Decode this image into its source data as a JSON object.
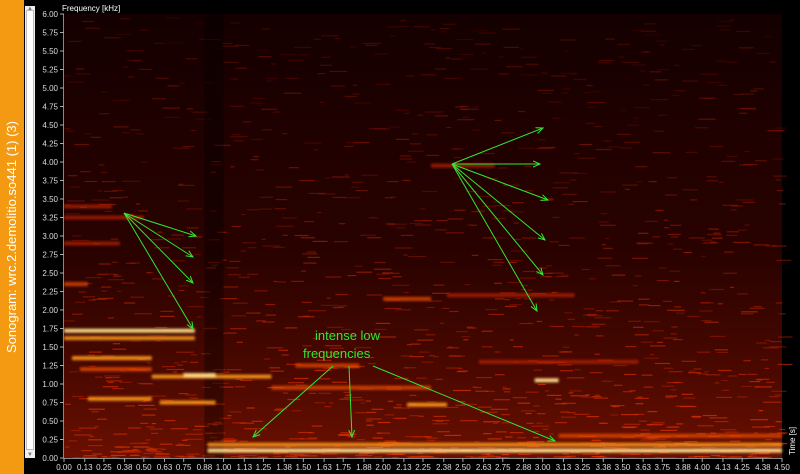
{
  "sidebar": {
    "title": "Sonogram: wrc.2.demolitio.so441 (1) (3)"
  },
  "chart_data": {
    "type": "heatmap",
    "title": "",
    "ylabel": "Frequency [kHz]",
    "xlabel": "Time [s]",
    "xlim": [
      0,
      4.5
    ],
    "ylim": [
      0,
      6
    ],
    "x_ticks": [
      "0.00",
      "0.13",
      "0.25",
      "0.38",
      "0.50",
      "0.63",
      "0.75",
      "0.88",
      "1.00",
      "1.13",
      "1.25",
      "1.38",
      "1.50",
      "1.63",
      "1.75",
      "1.88",
      "2.00",
      "2.13",
      "2.25",
      "2.38",
      "2.50",
      "2.63",
      "2.75",
      "2.88",
      "3.00",
      "3.13",
      "3.25",
      "3.38",
      "3.50",
      "3.63",
      "3.75",
      "3.88",
      "4.00",
      "4.13",
      "4.25",
      "4.38",
      "4.50"
    ],
    "y_ticks": [
      "0.00",
      "0.25",
      "0.50",
      "0.75",
      "1.00",
      "1.25",
      "1.50",
      "1.75",
      "2.00",
      "2.25",
      "2.50",
      "2.75",
      "3.00",
      "3.25",
      "3.50",
      "3.75",
      "4.00",
      "4.25",
      "4.50",
      "4.75",
      "5.00",
      "5.25",
      "5.50",
      "5.75",
      "6.00"
    ],
    "annotations": [
      {
        "text": "intense low frequencies",
        "lines": [
          "intense low",
          "frequencies"
        ]
      }
    ],
    "bright_bands": [
      {
        "t0": 0.0,
        "t1": 0.82,
        "f": 1.72,
        "i": 1.0
      },
      {
        "t0": 0.0,
        "t1": 0.82,
        "f": 1.62,
        "i": 0.8
      },
      {
        "t0": 0.05,
        "t1": 0.55,
        "f": 1.35,
        "i": 0.9
      },
      {
        "t0": 0.1,
        "t1": 0.55,
        "f": 1.2,
        "i": 0.7
      },
      {
        "t0": 0.55,
        "t1": 1.3,
        "f": 1.1,
        "i": 0.85
      },
      {
        "t0": 0.75,
        "t1": 0.95,
        "f": 1.12,
        "i": 1.0
      },
      {
        "t0": 0.15,
        "t1": 0.55,
        "f": 0.8,
        "i": 0.9
      },
      {
        "t0": 0.6,
        "t1": 0.95,
        "f": 0.75,
        "i": 0.85
      },
      {
        "t0": 1.3,
        "t1": 2.3,
        "f": 0.95,
        "i": 0.6
      },
      {
        "t0": 1.45,
        "t1": 1.85,
        "f": 1.25,
        "i": 0.6
      },
      {
        "t0": 2.15,
        "t1": 2.4,
        "f": 0.72,
        "i": 0.9
      },
      {
        "t0": 2.95,
        "t1": 3.1,
        "f": 1.05,
        "i": 1.0
      },
      {
        "t0": 0.0,
        "t1": 0.15,
        "f": 2.35,
        "i": 0.6
      },
      {
        "t0": 0.0,
        "t1": 0.35,
        "f": 2.9,
        "i": 0.5
      },
      {
        "t0": 0.0,
        "t1": 0.5,
        "f": 3.25,
        "i": 0.5
      },
      {
        "t0": 0.0,
        "t1": 0.3,
        "f": 3.4,
        "i": 0.5
      },
      {
        "t0": 2.4,
        "t1": 3.2,
        "f": 2.2,
        "i": 0.5
      },
      {
        "t0": 2.0,
        "t1": 2.3,
        "f": 2.15,
        "i": 0.6
      },
      {
        "t0": 2.6,
        "t1": 3.6,
        "f": 1.3,
        "i": 0.45
      },
      {
        "t0": 0.9,
        "t1": 4.5,
        "f": 0.1,
        "i": 1.0
      },
      {
        "t0": 0.9,
        "t1": 4.5,
        "f": 0.18,
        "i": 0.8
      },
      {
        "t0": 3.1,
        "t1": 4.5,
        "f": 0.3,
        "i": 0.6
      },
      {
        "t0": 2.3,
        "t1": 2.7,
        "f": 3.95,
        "i": 0.5
      }
    ]
  }
}
